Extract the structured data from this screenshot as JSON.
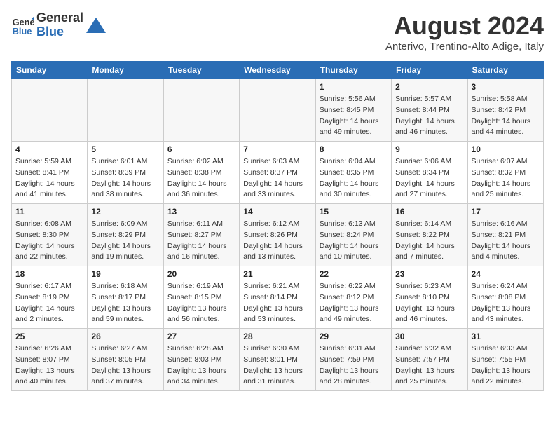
{
  "logo": {
    "line1": "General",
    "line2": "Blue"
  },
  "title": "August 2024",
  "subtitle": "Anterivo, Trentino-Alto Adige, Italy",
  "headers": [
    "Sunday",
    "Monday",
    "Tuesday",
    "Wednesday",
    "Thursday",
    "Friday",
    "Saturday"
  ],
  "weeks": [
    [
      {
        "day": "",
        "detail": ""
      },
      {
        "day": "",
        "detail": ""
      },
      {
        "day": "",
        "detail": ""
      },
      {
        "day": "",
        "detail": ""
      },
      {
        "day": "1",
        "detail": "Sunrise: 5:56 AM\nSunset: 8:45 PM\nDaylight: 14 hours\nand 49 minutes."
      },
      {
        "day": "2",
        "detail": "Sunrise: 5:57 AM\nSunset: 8:44 PM\nDaylight: 14 hours\nand 46 minutes."
      },
      {
        "day": "3",
        "detail": "Sunrise: 5:58 AM\nSunset: 8:42 PM\nDaylight: 14 hours\nand 44 minutes."
      }
    ],
    [
      {
        "day": "4",
        "detail": "Sunrise: 5:59 AM\nSunset: 8:41 PM\nDaylight: 14 hours\nand 41 minutes."
      },
      {
        "day": "5",
        "detail": "Sunrise: 6:01 AM\nSunset: 8:39 PM\nDaylight: 14 hours\nand 38 minutes."
      },
      {
        "day": "6",
        "detail": "Sunrise: 6:02 AM\nSunset: 8:38 PM\nDaylight: 14 hours\nand 36 minutes."
      },
      {
        "day": "7",
        "detail": "Sunrise: 6:03 AM\nSunset: 8:37 PM\nDaylight: 14 hours\nand 33 minutes."
      },
      {
        "day": "8",
        "detail": "Sunrise: 6:04 AM\nSunset: 8:35 PM\nDaylight: 14 hours\nand 30 minutes."
      },
      {
        "day": "9",
        "detail": "Sunrise: 6:06 AM\nSunset: 8:34 PM\nDaylight: 14 hours\nand 27 minutes."
      },
      {
        "day": "10",
        "detail": "Sunrise: 6:07 AM\nSunset: 8:32 PM\nDaylight: 14 hours\nand 25 minutes."
      }
    ],
    [
      {
        "day": "11",
        "detail": "Sunrise: 6:08 AM\nSunset: 8:30 PM\nDaylight: 14 hours\nand 22 minutes."
      },
      {
        "day": "12",
        "detail": "Sunrise: 6:09 AM\nSunset: 8:29 PM\nDaylight: 14 hours\nand 19 minutes."
      },
      {
        "day": "13",
        "detail": "Sunrise: 6:11 AM\nSunset: 8:27 PM\nDaylight: 14 hours\nand 16 minutes."
      },
      {
        "day": "14",
        "detail": "Sunrise: 6:12 AM\nSunset: 8:26 PM\nDaylight: 14 hours\nand 13 minutes."
      },
      {
        "day": "15",
        "detail": "Sunrise: 6:13 AM\nSunset: 8:24 PM\nDaylight: 14 hours\nand 10 minutes."
      },
      {
        "day": "16",
        "detail": "Sunrise: 6:14 AM\nSunset: 8:22 PM\nDaylight: 14 hours\nand 7 minutes."
      },
      {
        "day": "17",
        "detail": "Sunrise: 6:16 AM\nSunset: 8:21 PM\nDaylight: 14 hours\nand 4 minutes."
      }
    ],
    [
      {
        "day": "18",
        "detail": "Sunrise: 6:17 AM\nSunset: 8:19 PM\nDaylight: 14 hours\nand 2 minutes."
      },
      {
        "day": "19",
        "detail": "Sunrise: 6:18 AM\nSunset: 8:17 PM\nDaylight: 13 hours\nand 59 minutes."
      },
      {
        "day": "20",
        "detail": "Sunrise: 6:19 AM\nSunset: 8:15 PM\nDaylight: 13 hours\nand 56 minutes."
      },
      {
        "day": "21",
        "detail": "Sunrise: 6:21 AM\nSunset: 8:14 PM\nDaylight: 13 hours\nand 53 minutes."
      },
      {
        "day": "22",
        "detail": "Sunrise: 6:22 AM\nSunset: 8:12 PM\nDaylight: 13 hours\nand 49 minutes."
      },
      {
        "day": "23",
        "detail": "Sunrise: 6:23 AM\nSunset: 8:10 PM\nDaylight: 13 hours\nand 46 minutes."
      },
      {
        "day": "24",
        "detail": "Sunrise: 6:24 AM\nSunset: 8:08 PM\nDaylight: 13 hours\nand 43 minutes."
      }
    ],
    [
      {
        "day": "25",
        "detail": "Sunrise: 6:26 AM\nSunset: 8:07 PM\nDaylight: 13 hours\nand 40 minutes."
      },
      {
        "day": "26",
        "detail": "Sunrise: 6:27 AM\nSunset: 8:05 PM\nDaylight: 13 hours\nand 37 minutes."
      },
      {
        "day": "27",
        "detail": "Sunrise: 6:28 AM\nSunset: 8:03 PM\nDaylight: 13 hours\nand 34 minutes."
      },
      {
        "day": "28",
        "detail": "Sunrise: 6:30 AM\nSunset: 8:01 PM\nDaylight: 13 hours\nand 31 minutes."
      },
      {
        "day": "29",
        "detail": "Sunrise: 6:31 AM\nSunset: 7:59 PM\nDaylight: 13 hours\nand 28 minutes."
      },
      {
        "day": "30",
        "detail": "Sunrise: 6:32 AM\nSunset: 7:57 PM\nDaylight: 13 hours\nand 25 minutes."
      },
      {
        "day": "31",
        "detail": "Sunrise: 6:33 AM\nSunset: 7:55 PM\nDaylight: 13 hours\nand 22 minutes."
      }
    ]
  ]
}
